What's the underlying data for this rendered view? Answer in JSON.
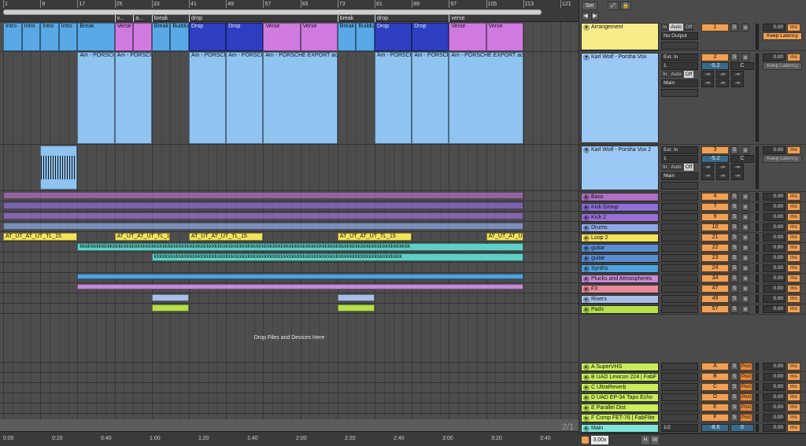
{
  "ruler": {
    "bars": [
      "1",
      "9",
      "17",
      "25",
      "33",
      "41",
      "49",
      "57",
      "65",
      "73",
      "81",
      "89",
      "97",
      "105",
      "113",
      "121"
    ],
    "locators": [
      "v...",
      "a...",
      "break",
      "drop",
      "break",
      "drop",
      "verse"
    ]
  },
  "clips": {
    "sections": [
      "Intro",
      "Intro",
      "Intro",
      "Intro",
      "Break",
      "Verse",
      "Break",
      "Buildup",
      "Drop",
      "Drop",
      "Verse",
      "Verse",
      "Break",
      "Buildup",
      "Drop",
      "Drop",
      "Verse",
      "Verse"
    ],
    "audio_name_1": "Am - PORSCHE EXPORT aca",
    "audio_name_2": "Am - PORSCHE EXPORT aca",
    "audio_name_3": "Am - PORSCHE",
    "audio_name_4": "Am - PORSCHE EXPORT aca",
    "audio_name_5": "Am - PORSCHE EXPORT aca",
    "audio_name_6": "Am - PORSCHE",
    "audio_name_7": "Am - PORSCHE",
    "audio_name_8": "Am - PORSCHE EXPORT aca",
    "loop_label_a": "AT_UT",
    "loop_label_b": "TL_15",
    "guitar_label": "k"
  },
  "drop_hint": "Drop Files and Devices Here",
  "time_labels": [
    "0:00",
    "0:20",
    "0:40",
    "1:00",
    "1:20",
    "1:40",
    "2:00",
    "2:20",
    "2:40",
    "3:00",
    "3:20",
    "3:40"
  ],
  "zoom_page": "2/1",
  "mixer": {
    "top_buttons": [
      "Set",
      "⤢",
      "🔒"
    ],
    "nav_left": "◀",
    "nav_right": "▶",
    "arrangement": {
      "name": "Arrangement",
      "monitor": [
        "In",
        "Auto",
        "Off"
      ],
      "output": "No Output",
      "number": "1",
      "solo": "S",
      "delay": "0.00",
      "ms": "ms",
      "keep": "Keep Latency"
    },
    "vox1": {
      "name": "Karl Wolf - Porsha Vox",
      "input": "Ext. In",
      "channel": "1",
      "monitor": [
        "In",
        "Auto",
        "Off"
      ],
      "output": "Main",
      "number": "2",
      "solo": "S",
      "volume": "-5.2",
      "pan": "C",
      "sends": [
        "-∞",
        "-∞",
        "-∞"
      ],
      "sends2": [
        "-∞",
        "-∞",
        "-∞"
      ],
      "delay": "0.00",
      "ms": "ms",
      "keep": "Keep Latency"
    },
    "vox2": {
      "name": "Karl Wolf - Porsha Vox 2",
      "input": "Ext. In",
      "channel": "1",
      "monitor": [
        "In",
        "Auto",
        "Off"
      ],
      "output": "Main",
      "number": "3",
      "solo": "S",
      "volume": "-5.2",
      "pan": "C",
      "sends": [
        "-∞",
        "-∞",
        "-∞"
      ],
      "sends2": [
        "-∞",
        "-∞",
        "-∞"
      ],
      "delay": "0.00",
      "ms": "ms",
      "keep": "Keep Latency"
    },
    "tracks": [
      {
        "name": "Bass",
        "number": "4",
        "color": "#b06fc2"
      },
      {
        "name": "Kick Group",
        "number": "7",
        "color": "#8d6fd6"
      },
      {
        "name": "Kick 2",
        "number": "9",
        "color": "#9a6fd6"
      },
      {
        "name": "Drums",
        "number": "10",
        "color": "#8fa9e8"
      },
      {
        "name": "Loop 2",
        "number": "21",
        "color": "#f2e35b"
      },
      {
        "name": "guitar",
        "number": "22",
        "color": "#5a8fd6"
      },
      {
        "name": "guitar",
        "number": "23",
        "color": "#5a8fd6"
      },
      {
        "name": "Synths",
        "number": "24",
        "color": "#4fa3e0"
      },
      {
        "name": "Plucks and Atmospheres",
        "number": "34",
        "color": "#c68ad6"
      },
      {
        "name": "FX",
        "number": "47",
        "color": "#e88a9a"
      },
      {
        "name": "Risers",
        "number": "49",
        "color": "#a8c0e8"
      },
      {
        "name": "Pads",
        "number": "57",
        "color": "#b6e04a"
      }
    ],
    "returns": [
      {
        "name": "A SuperVHS",
        "letter": "A"
      },
      {
        "name": "B UAD Lexicon 224 | FabF",
        "letter": "B"
      },
      {
        "name": "C UltraReverb",
        "letter": "C"
      },
      {
        "name": "D UAD EP-34 Tapo Echo",
        "letter": "D"
      },
      {
        "name": "E Parallel Dist",
        "letter": "E"
      },
      {
        "name": "F Comp FET-76 | FabFilte",
        "letter": "F"
      }
    ],
    "return_solo": "S",
    "return_post": "Post",
    "delay_value": "0.00",
    "ms": "ms",
    "main": {
      "name": "Main",
      "output": "1/2",
      "volume": "-8.6",
      "pan": "0",
      "delay": "0.00",
      "ms": "ms"
    },
    "bottom": {
      "zoom": "3.00x",
      "h": "H",
      "w": "W"
    },
    "colors": {
      "arrangement": "#f6ec8a",
      "vox": "#9cc8f5",
      "return_track": "#c9ee5a",
      "main": "#7fe6d9"
    }
  }
}
